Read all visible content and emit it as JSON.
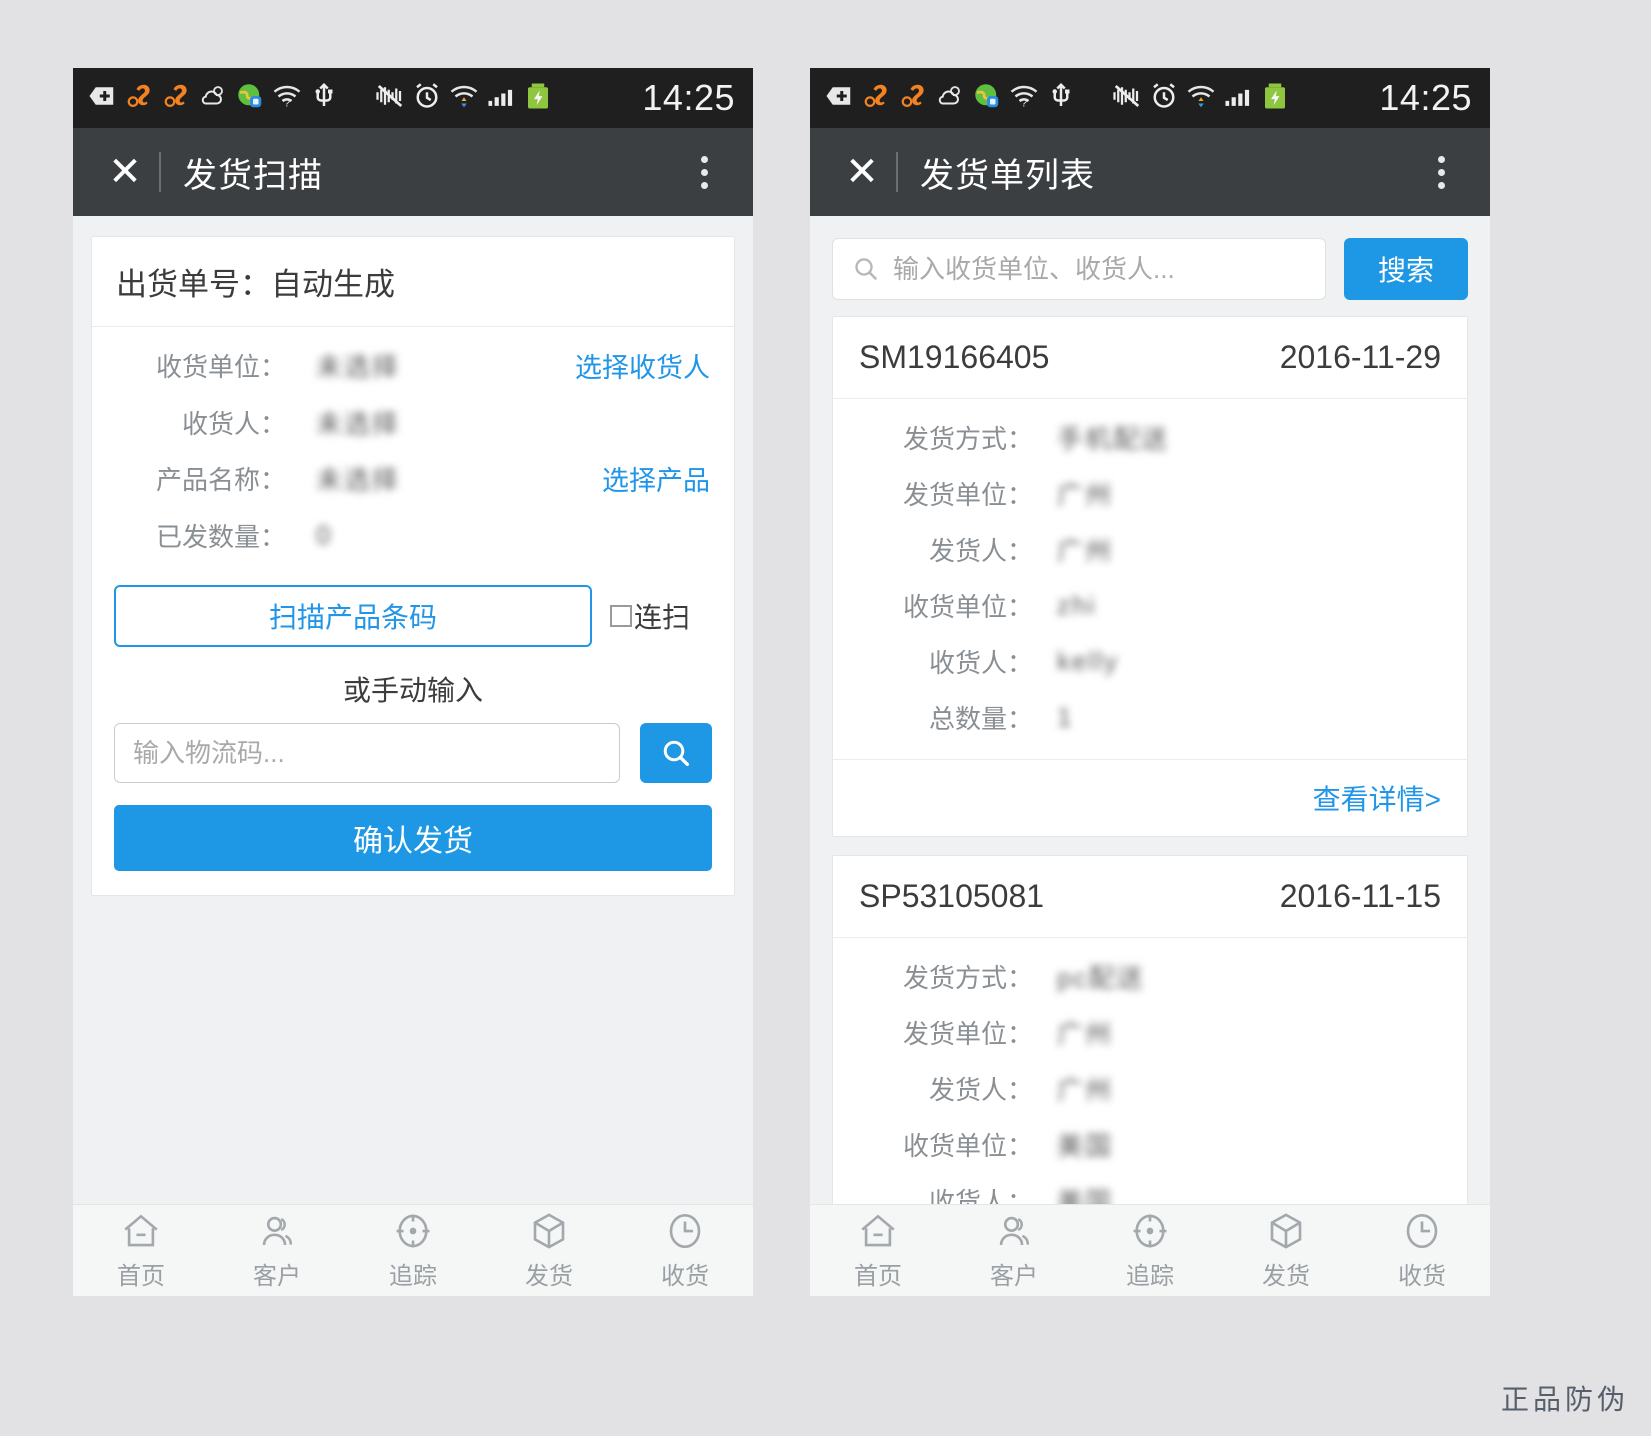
{
  "status_bar": {
    "time": "14:25",
    "icons": [
      "plus-badge-icon",
      "uc-browser-icon",
      "uc-browser-icon",
      "weather-cloud-icon",
      "map-location-icon",
      "wifi-question-icon",
      "usb-icon",
      "vibrate-mute-icon",
      "alarm-clock-icon",
      "wifi-signal-icon",
      "cell-signal-icon",
      "battery-charging-icon"
    ]
  },
  "left_screen": {
    "titlebar": {
      "close_label": "✕",
      "title": "发货扫描",
      "more_label": "more-options"
    },
    "form": {
      "header": "出货单号：自动生成",
      "rows": [
        {
          "label": "收货单位：",
          "value": "未选择",
          "action": "选择收货人"
        },
        {
          "label": "收货人：",
          "value": "未选择",
          "action": ""
        },
        {
          "label": "产品名称：",
          "value": "未选择",
          "action": "选择产品"
        },
        {
          "label": "已发数量：",
          "value": "0",
          "action": ""
        }
      ],
      "scan_button": "扫描产品条码",
      "continuous_scan_label": "连扫",
      "continuous_scan_checked": false,
      "or_text": "或手动输入",
      "code_placeholder": "输入物流码...",
      "code_value": "",
      "mini_search_icon": "search-icon",
      "confirm_button": "确认发货"
    }
  },
  "right_screen": {
    "titlebar": {
      "close_label": "✕",
      "title": "发货单列表",
      "more_label": "more-options"
    },
    "search": {
      "icon": "search-icon",
      "placeholder": "输入收货单位、收货人...",
      "value": "",
      "button_label": "搜索"
    },
    "cards": [
      {
        "order_no": "SM19166405",
        "date": "2016-11-29",
        "rows": [
          {
            "label": "发货方式：",
            "value": "手机配送"
          },
          {
            "label": "发货单位：",
            "value": "广州"
          },
          {
            "label": "发货人：",
            "value": "广州"
          },
          {
            "label": "收货单位：",
            "value": "zhi"
          },
          {
            "label": "收货人：",
            "value": "kelly"
          },
          {
            "label": "总数量：",
            "value": "1"
          }
        ],
        "detail_link": "查看详情>"
      },
      {
        "order_no": "SP53105081",
        "date": "2016-11-15",
        "rows": [
          {
            "label": "发货方式：",
            "value": "pc配送"
          },
          {
            "label": "发货单位：",
            "value": "广州"
          },
          {
            "label": "发货人：",
            "value": "广州"
          },
          {
            "label": "收货单位：",
            "value": "美国"
          },
          {
            "label": "收货人：",
            "value": "美国"
          }
        ],
        "detail_link": ""
      }
    ]
  },
  "tabbar": {
    "items": [
      {
        "label": "首页",
        "icon": "home-icon"
      },
      {
        "label": "客户",
        "icon": "users-icon"
      },
      {
        "label": "追踪",
        "icon": "target-icon"
      },
      {
        "label": "发货",
        "icon": "box-icon"
      },
      {
        "label": "收货",
        "icon": "clock-icon"
      }
    ]
  },
  "watermark": "正品防伪",
  "colors": {
    "accent": "#1e97e4",
    "link": "#2196e8",
    "titlebar": "#3b3f42",
    "statusbar": "#1f1f1f",
    "page_bg": "#eff1f3",
    "outer_bg": "#e2e2e4"
  }
}
